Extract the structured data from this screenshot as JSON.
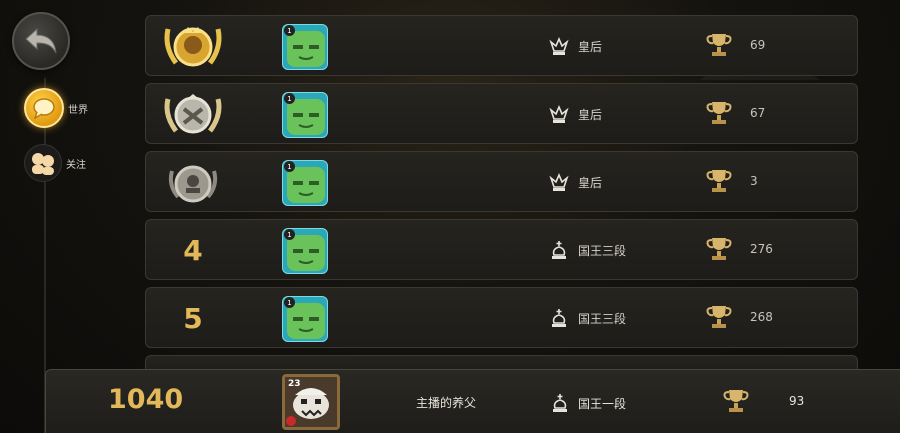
{
  "sidebar": {
    "tabs": [
      {
        "label": "世界",
        "icon": "chat-bubble-icon",
        "selected": true
      },
      {
        "label": "关注",
        "icon": "friends-icon",
        "selected": false
      }
    ]
  },
  "colors": {
    "accent_gold": "#e2b85a",
    "avatar_teal": "#2aa7b8"
  },
  "leaderboard": {
    "rows": [
      {
        "rank_badge": "gold-rank-badge-icon",
        "level": "1",
        "tier": "皇后",
        "tier_icon": "queen-crown-icon",
        "trophies": "69"
      },
      {
        "rank_badge": "silver-rank-badge-icon",
        "level": "1",
        "tier": "皇后",
        "tier_icon": "queen-crown-icon",
        "trophies": "67"
      },
      {
        "rank_badge": "bronze-rank-badge-icon",
        "level": "1",
        "tier": "皇后",
        "tier_icon": "queen-crown-icon",
        "trophies": "3"
      },
      {
        "rank": "4",
        "level": "1",
        "tier": "国王三段",
        "tier_icon": "king-chess-icon",
        "trophies": "276"
      },
      {
        "rank": "5",
        "level": "1",
        "tier": "国王三段",
        "tier_icon": "king-chess-icon",
        "trophies": "268"
      }
    ]
  },
  "my_entry": {
    "rank": "1040",
    "level": "23",
    "name": "主播的养父",
    "tier": "国王一段",
    "tier_icon": "king-chess-icon",
    "trophies": "93"
  }
}
